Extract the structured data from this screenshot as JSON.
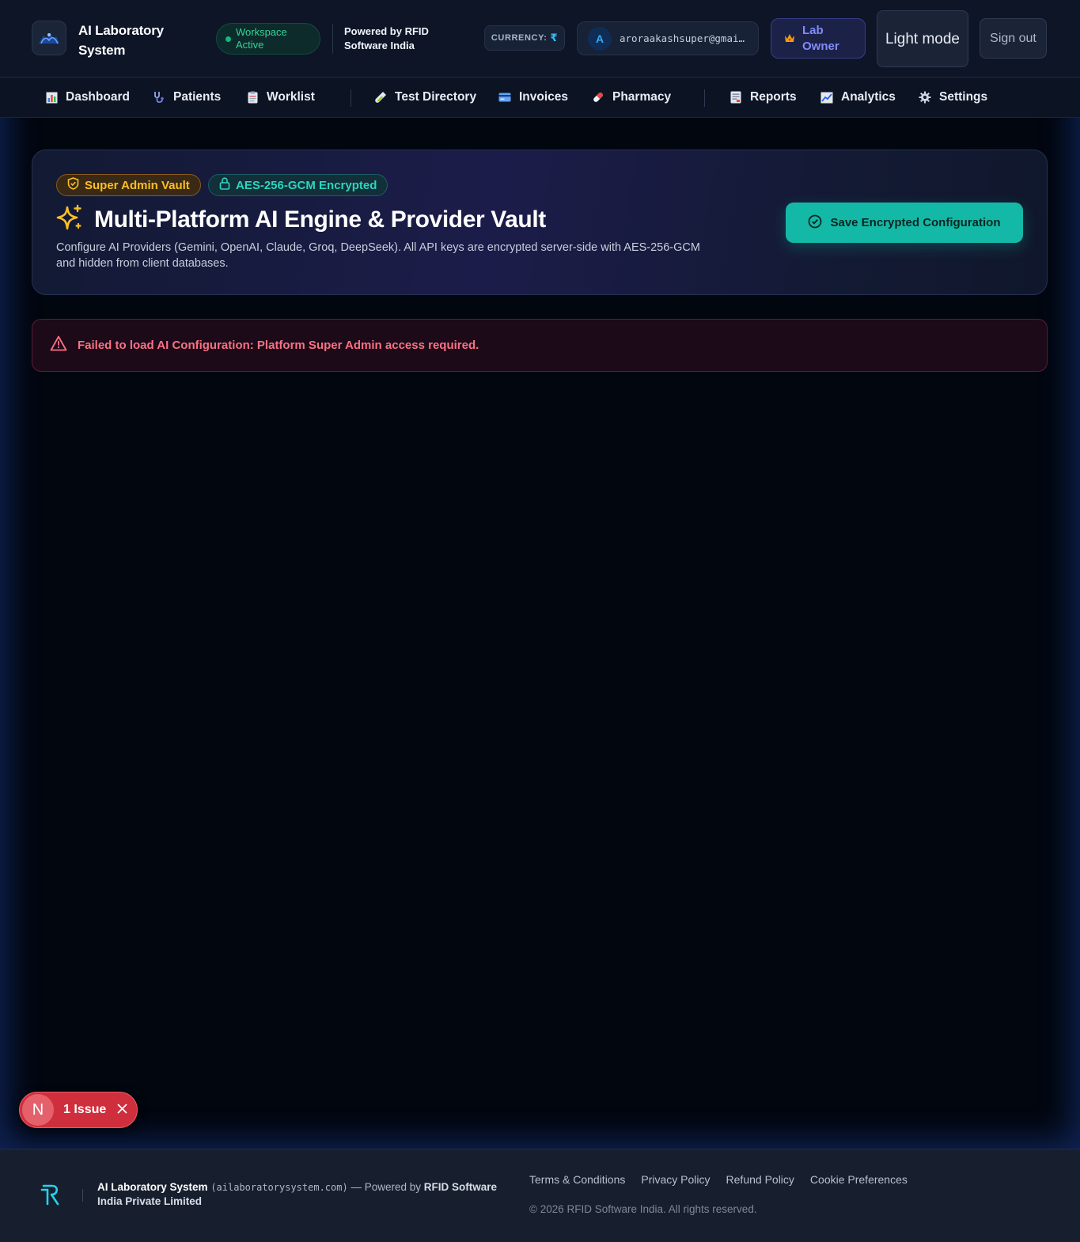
{
  "header": {
    "logo_icon": "lab-logo-icon",
    "app_title": "AI Laboratory System",
    "workspace_status": "Workspace Active",
    "powered_by": "Powered by RFID Software India",
    "currency_label": "CURRENCY:",
    "currency_symbol": "₹",
    "user_initial": "A",
    "user_email": "aroraakashsuper@gmai…",
    "role_label": "Lab Owner",
    "theme_toggle_label": "Light mode",
    "sign_out_label": "Sign out"
  },
  "nav": {
    "items": [
      {
        "label": "Dashboard",
        "icon": "bar-chart-icon"
      },
      {
        "label": "Patients",
        "icon": "stethoscope-icon"
      },
      {
        "label": "Worklist",
        "icon": "clipboard-icon"
      },
      {
        "label": "Test Directory",
        "icon": "test-tube-icon"
      },
      {
        "label": "Invoices",
        "icon": "credit-card-icon"
      },
      {
        "label": "Pharmacy",
        "icon": "pill-icon"
      },
      {
        "label": "Reports",
        "icon": "report-icon"
      },
      {
        "label": "Analytics",
        "icon": "trend-chart-icon"
      },
      {
        "label": "Settings",
        "icon": "gear-icon"
      }
    ]
  },
  "hero": {
    "badge_vault": "Super Admin Vault",
    "badge_encryption": "AES-256-GCM Encrypted",
    "title": "Multi-Platform AI Engine & Provider Vault",
    "description": "Configure AI Providers (Gemini, OpenAI, Claude, Groq, DeepSeek). All API keys are encrypted server-side with AES-256-GCM and hidden from client databases.",
    "save_button": "Save Encrypted Configuration"
  },
  "error": {
    "message": "Failed to load AI Configuration: Platform Super Admin access required."
  },
  "issue_indicator": {
    "initial": "N",
    "label": "1 Issue"
  },
  "footer": {
    "brand_name": "AI Laboratory System",
    "domain": "(ailaboratorysystem.com)",
    "powered_prefix": "— Powered by",
    "company": "RFID Software India Private Limited",
    "links": [
      "Terms & Conditions",
      "Privacy Policy",
      "Refund Policy",
      "Cookie Preferences"
    ],
    "copyright": "© 2026 RFID Software India. All rights reserved."
  },
  "colors": {
    "accent_teal": "#14b8a6",
    "warning_amber": "#fbbf24",
    "error_red": "#fb7185",
    "status_green": "#34d399",
    "indigo": "#818cf8"
  }
}
